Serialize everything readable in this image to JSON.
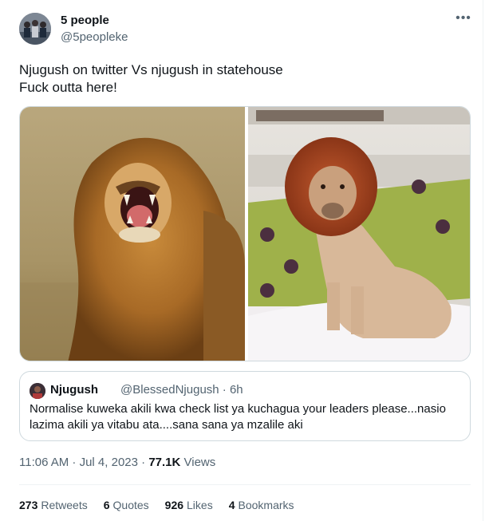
{
  "author": {
    "name": "5 people",
    "handle": "@5peopleke"
  },
  "tweet": {
    "line1": "Njugush on twitter Vs njugush in statehouse",
    "line2": "Fuck outta here!"
  },
  "quote": {
    "name": "Njugush",
    "meta": "@BlessedNjugush · 6h",
    "text": "Normalise kuweka akili kwa check list ya kuchagua your leaders please...nasio lazima akili ya vitabu ata....sana sana ya mzalile aki"
  },
  "meta": {
    "time": "11:06 AM · Jul 4, 2023 · ",
    "views_count": "77.1K",
    "views_label": " Views"
  },
  "stats": {
    "retweets": {
      "count": "273",
      "label": "Retweets"
    },
    "quotes": {
      "count": "6",
      "label": "Quotes"
    },
    "likes": {
      "count": "926",
      "label": "Likes"
    },
    "bookmarks": {
      "count": "4",
      "label": "Bookmarks"
    }
  },
  "icons": {
    "more": "more-icon"
  }
}
